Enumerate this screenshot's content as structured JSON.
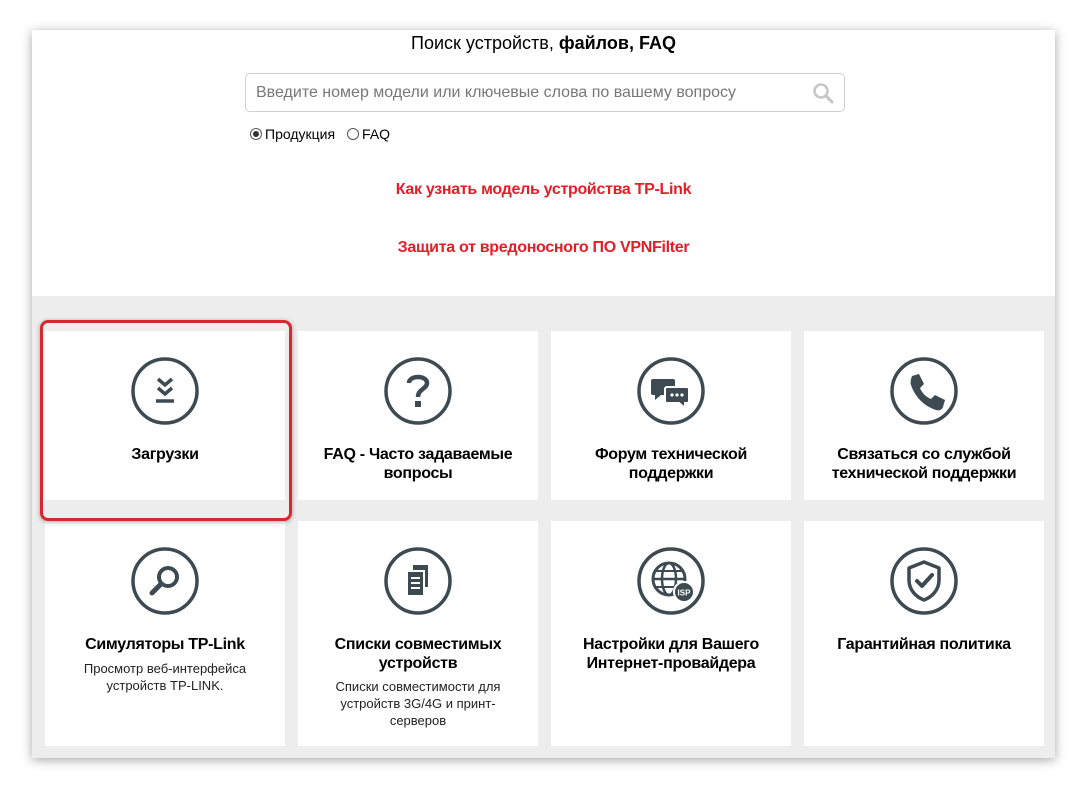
{
  "search": {
    "title_normal": "Поиск устройств, ",
    "title_bold": "файлов, FAQ",
    "placeholder": "Введите номер модели или ключевые слова по вашему вопросу",
    "options": [
      {
        "label": "Продукция",
        "checked": true
      },
      {
        "label": "FAQ",
        "checked": false
      }
    ]
  },
  "links": [
    {
      "label": "Как узнать модель устройства TP-Link"
    },
    {
      "label": "Защита от вредоносного ПО VPNFilter"
    }
  ],
  "cards": [
    {
      "title": "Загрузки",
      "description": "",
      "icon": "download-icon"
    },
    {
      "title": "FAQ - Часто задаваемые вопросы",
      "description": "",
      "icon": "question-icon"
    },
    {
      "title": "Форум технической поддержки",
      "description": "",
      "icon": "chat-icon"
    },
    {
      "title": "Связаться со службой технической поддержки",
      "description": "",
      "icon": "phone-icon"
    },
    {
      "title": "Симуляторы TP-Link",
      "description": "Просмотр веб-интерфейса устройств TP-LINK.",
      "icon": "magnifier-icon"
    },
    {
      "title": "Списки совместимых устройств",
      "description": "Списки совместимости для устройств 3G/4G и принт-серверов",
      "icon": "document-list-icon"
    },
    {
      "title": "Настройки для Вашего Интернет-провайдера",
      "description": "",
      "icon": "globe-isp-icon",
      "badge": "ISP"
    },
    {
      "title": "Гарантийная политика",
      "description": "",
      "icon": "shield-check-icon"
    }
  ],
  "colors": {
    "accent_red": "#e41e26",
    "icon_dark": "#3d4a52",
    "grid_background": "#ededed",
    "highlight_border": "#d7282f"
  }
}
